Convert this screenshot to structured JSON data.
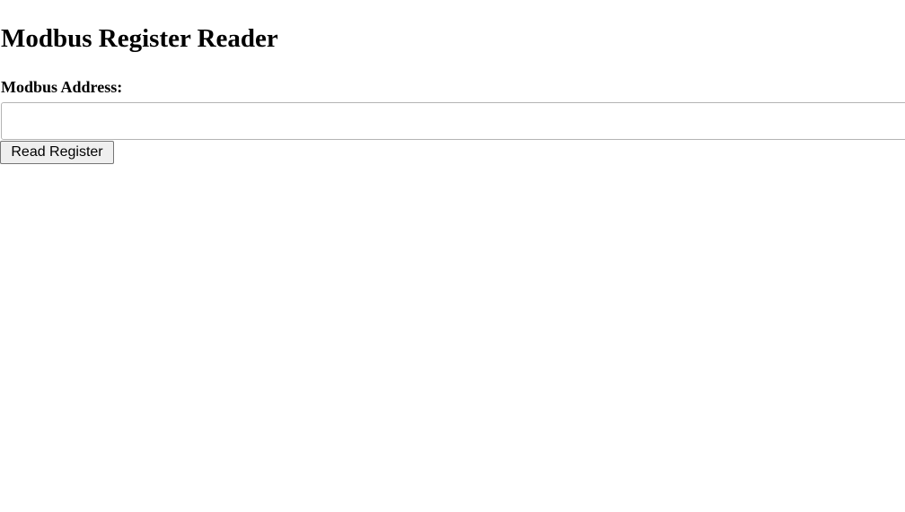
{
  "page": {
    "title": "Modbus Register Reader"
  },
  "form": {
    "address_label": "Modbus Address:",
    "address_value": "",
    "read_button_label": "Read Register"
  },
  "colors": {
    "background": "#ffffff",
    "text": "#000000",
    "button_background": "#efefef",
    "input_border": "#b4b4b4"
  }
}
